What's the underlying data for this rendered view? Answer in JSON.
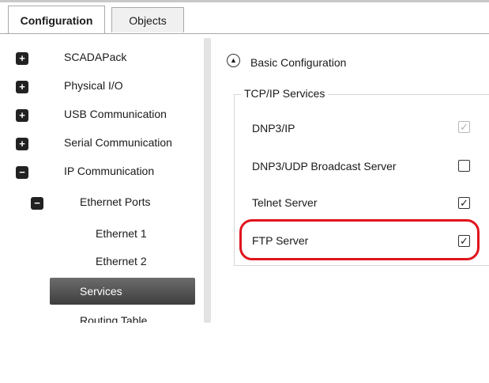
{
  "tabs": [
    {
      "label": "Configuration",
      "active": true
    },
    {
      "label": "Objects",
      "active": false
    }
  ],
  "tree": {
    "items": [
      {
        "label": "SCADAPack",
        "toggle": "+"
      },
      {
        "label": "Physical I/O",
        "toggle": "+"
      },
      {
        "label": "USB Communication",
        "toggle": "+"
      },
      {
        "label": "Serial Communication",
        "toggle": "+"
      },
      {
        "label": "IP Communication",
        "toggle": "−"
      },
      {
        "label": "Ethernet Ports",
        "toggle": "−"
      },
      {
        "label": "Ethernet 1"
      },
      {
        "label": "Ethernet 2"
      },
      {
        "label": "Services",
        "selected": true
      },
      {
        "label": "Routing Table"
      }
    ]
  },
  "panel": {
    "title": "Basic Configuration",
    "collapse_icon": "chevron-up-icon",
    "group_title": "TCP/IP Services",
    "services": [
      {
        "label": "DNP3/IP",
        "checked": true,
        "disabled": true
      },
      {
        "label": "DNP3/UDP Broadcast Server",
        "checked": false,
        "disabled": false
      },
      {
        "label": "Telnet Server",
        "checked": true,
        "disabled": false
      },
      {
        "label": "FTP Server",
        "checked": true,
        "disabled": false
      }
    ]
  },
  "colors": {
    "highlight": "#e0141c",
    "selected_item": "#4a4a4a"
  }
}
